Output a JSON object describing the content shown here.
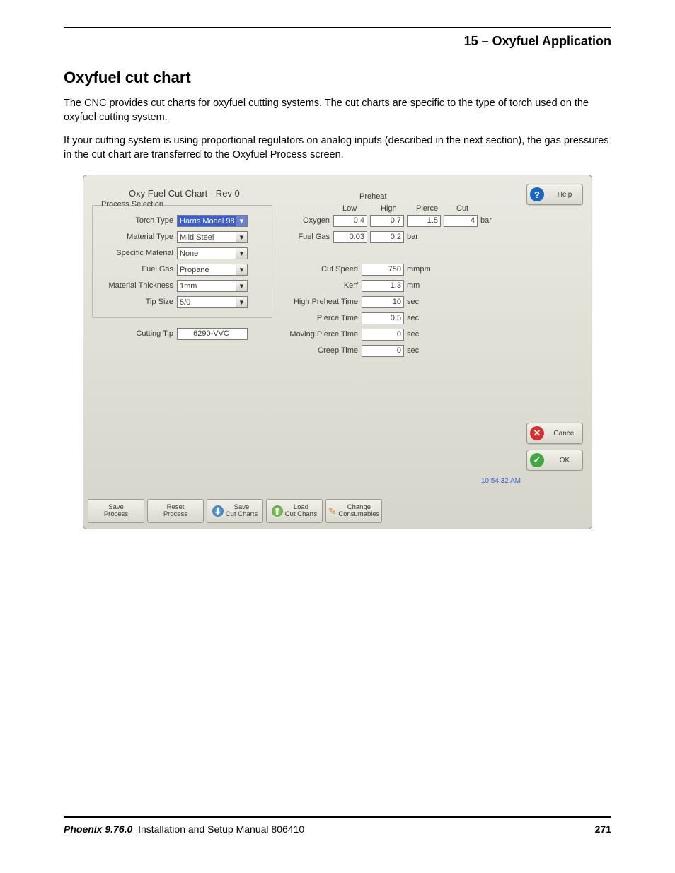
{
  "doc": {
    "header_section": "15  –  Oxyfuel Application",
    "section_title": "Oxyfuel cut chart",
    "para1": "The CNC provides cut charts for oxyfuel cutting systems. The cut charts are specific to the type of torch used on the oxyfuel cutting system.",
    "para2": "If your cutting system is using proportional regulators on analog inputs (described in the next section), the gas pressures in the cut chart are transferred to the Oxyfuel Process screen.",
    "footer_product": "Phoenix 9.76.0",
    "footer_nbsp": " ",
    "footer_manual": "Installation and Setup Manual  806410",
    "footer_page": "271"
  },
  "ss": {
    "title": "Oxy Fuel Cut Chart - Rev 0",
    "process_selection": {
      "group": "Process Selection",
      "fields": {
        "torch_type": {
          "label": "Torch Type",
          "value": "Harris Model 98"
        },
        "material_type": {
          "label": "Material Type",
          "value": "Mild Steel"
        },
        "specific_material": {
          "label": "Specific Material",
          "value": "None"
        },
        "fuel_gas": {
          "label": "Fuel Gas",
          "value": "Propane"
        },
        "material_thickness": {
          "label": "Material Thickness",
          "value": "1mm"
        },
        "tip_size": {
          "label": "Tip Size",
          "value": "5/0"
        }
      },
      "cutting_tip": {
        "label": "Cutting Tip",
        "value": "6290-VVC"
      }
    },
    "preheat": {
      "header": "Preheat",
      "cols": {
        "low": "Low",
        "high": "High",
        "pierce": "Pierce",
        "cut": "Cut"
      },
      "oxygen": {
        "label": "Oxygen",
        "low": "0.4",
        "high": "0.7",
        "pierce": "1.5",
        "cut": "4",
        "unit": "bar"
      },
      "fuel_gas": {
        "label": "Fuel Gas",
        "low": "0.03",
        "high": "0.2",
        "unit": "bar"
      }
    },
    "params": {
      "cut_speed": {
        "label": "Cut Speed",
        "value": "750",
        "unit": "mmpm"
      },
      "kerf": {
        "label": "Kerf",
        "value": "1.3",
        "unit": "mm"
      },
      "high_preheat_time": {
        "label": "High Preheat Time",
        "value": "10",
        "unit": "sec"
      },
      "pierce_time": {
        "label": "Pierce Time",
        "value": "0.5",
        "unit": "sec"
      },
      "moving_pierce_time": {
        "label": "Moving Pierce Time",
        "value": "0",
        "unit": "sec"
      },
      "creep_time": {
        "label": "Creep Time",
        "value": "0",
        "unit": "sec"
      }
    },
    "buttons": {
      "help": "Help",
      "cancel": "Cancel",
      "ok": "OK"
    },
    "clock": "10:54:32 AM",
    "bottom": {
      "save_process": "Save\nProcess",
      "reset_process": "Reset\nProcess",
      "save_cut_charts": "Save\nCut Charts",
      "load_cut_charts": "Load\nCut Charts",
      "change_consumables": "Change\nConsumables"
    }
  }
}
